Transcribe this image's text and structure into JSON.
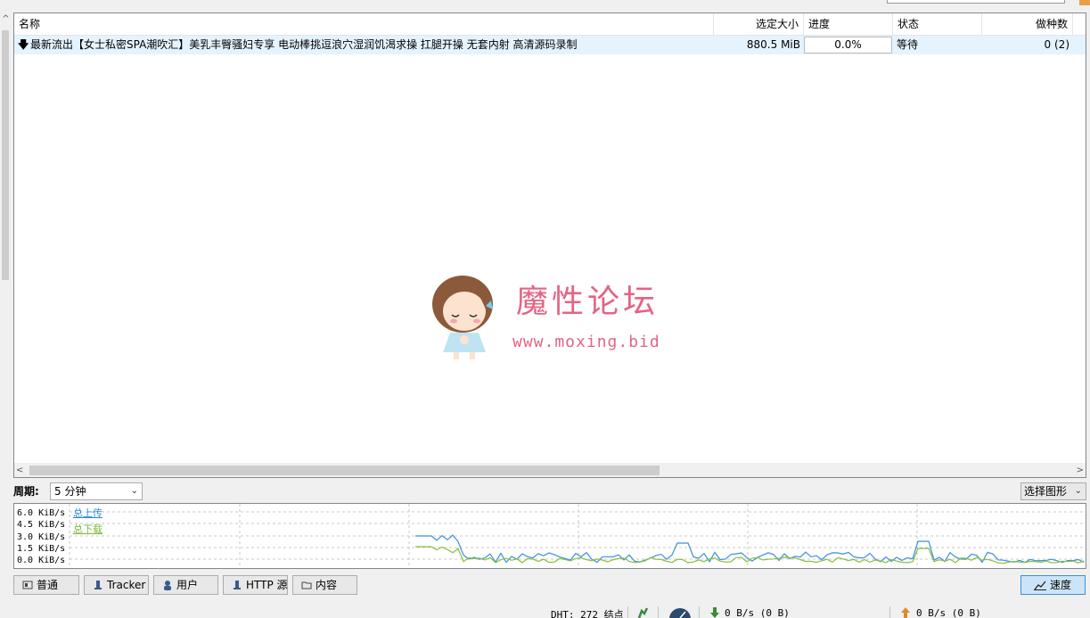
{
  "torrent_list": {
    "columns": {
      "name": "名称",
      "selected_size": "选定大小",
      "progress": "进度",
      "status": "状态",
      "seeds": "做种数"
    },
    "rows": [
      {
        "name": "最新流出【女士私密SPA潮吹汇】美乳丰臀骚妇专享 电动棒挑逗浪穴湿润饥渴求操 扛腿开操 无套内射 高清源码录制",
        "selected_size": "880.5 MiB",
        "progress": "0.0%",
        "status": "等待",
        "seeds": "0 (2)"
      }
    ]
  },
  "watermark": {
    "title": "魔性论坛",
    "url": "www.moxing.bid"
  },
  "speed_panel": {
    "period_label": "周期:",
    "period_value": "5 分钟",
    "graph_select": "选择图形",
    "y_ticks": [
      "6.0 KiB/s",
      "4.5 KiB/s",
      "3.0 KiB/s",
      "1.5 KiB/s",
      "0.0 KiB/s"
    ],
    "legend_upload": "总上传",
    "legend_download": "总下载",
    "colors": {
      "upload": "#3b8fe0",
      "download": "#86c03a"
    }
  },
  "tabs": {
    "general": "普通",
    "tracker": "Tracker",
    "peers": "用户",
    "http": "HTTP 源",
    "content": "内容",
    "speed": "速度"
  },
  "status_bar": {
    "dht": "DHT: 272 结点",
    "download": "0 B/s (0 B)",
    "upload": "0 B/s (0 B)"
  }
}
